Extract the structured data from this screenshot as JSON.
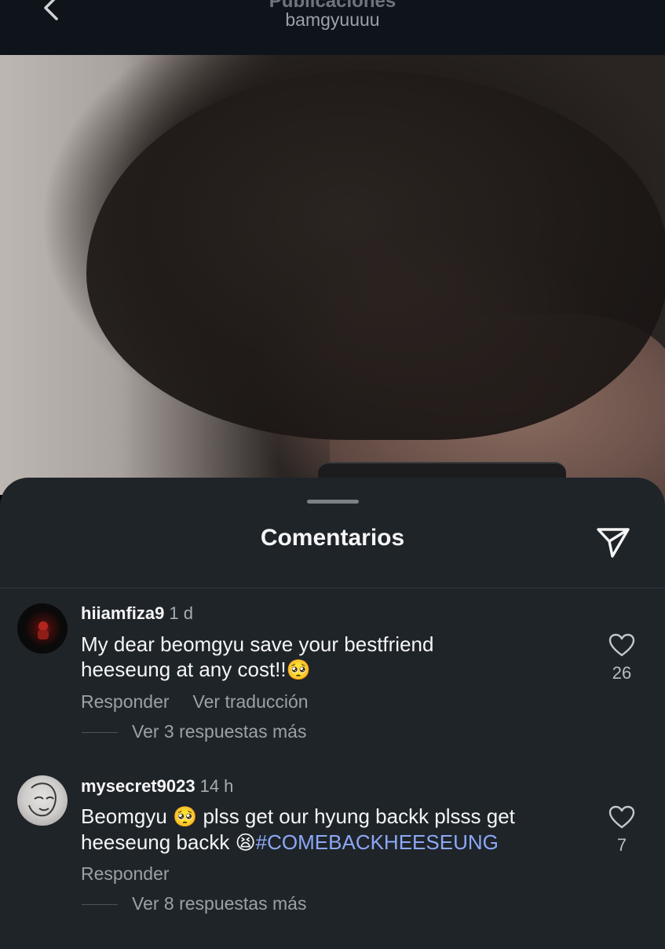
{
  "header": {
    "title": "Publicaciones",
    "subtitle": "bamgyuuuu",
    "back_icon": "chevron-left-icon"
  },
  "sheet": {
    "title": "Comentarios",
    "share_icon": "send-icon"
  },
  "comments": [
    {
      "username": "hiiamfiza9",
      "time": "1 d",
      "text_line1": "My dear beomgyu save your bestfriend",
      "text_line2": "heeseung at any cost!!",
      "emoji": "🥺",
      "reply_label": "Responder",
      "translate_label": "Ver traducción",
      "more_replies": "Ver 3 respuestas más",
      "likes": "26"
    },
    {
      "username": "mysecret9023",
      "time": "14 h",
      "text_part1": "Beomgyu",
      "emoji1": "🥺",
      "text_part2": "plss get our hyung backk plsss get",
      "text_line2": "heeseung backk",
      "emoji2": "😫",
      "hashtag": "#COMEBACKHEESEUNG",
      "reply_label": "Responder",
      "more_replies": "Ver 8 respuestas más",
      "likes": "7"
    }
  ],
  "colors": {
    "background": "#1f2429",
    "hashtag": "#8ca8f5",
    "muted": "#9ba1a7"
  }
}
